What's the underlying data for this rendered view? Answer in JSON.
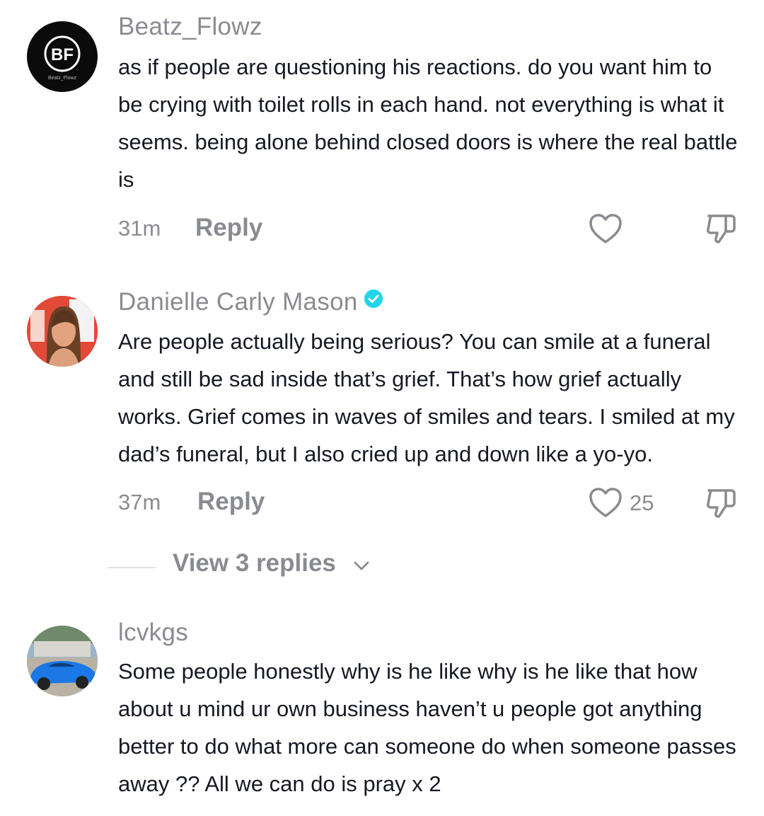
{
  "comments": [
    {
      "username": "Beatz_Flowz",
      "avatar": {
        "logo_text": "BF",
        "caption": "Beatz_Flowz"
      },
      "text": "as if people are questioning his reactions. do you want him to be crying with toilet rolls in each hand. not everything is what it seems. being alone behind closed doors is where the real battle is",
      "time": "31m",
      "reply_label": "Reply",
      "like_count": ""
    },
    {
      "username": "Danielle Carly Mason",
      "verified": true,
      "text": "Are people actually being serious? You can smile at a funeral and still be sad inside that’s grief. That’s how grief actually works. Grief comes in waves of smiles and tears. I smiled at my dad’s funeral, but I also cried up and down like a yo-yo.",
      "time": "37m",
      "reply_label": "Reply",
      "like_count": "25",
      "view_replies_label": "View 3 replies"
    },
    {
      "username": "lcvkgs",
      "text": "Some people honestly why is he like why is he like that how about u mind ur own business haven’t u people got anything better to do what more can someone do when someone passes away ?? All we can do is pray x 2"
    }
  ],
  "colors": {
    "text": "#161823",
    "secondary": "#8a8b91",
    "verified": "#20d5ec"
  },
  "icons": [
    "heart-icon",
    "dislike-icon",
    "chevron-down-icon",
    "verified-badge-icon"
  ]
}
